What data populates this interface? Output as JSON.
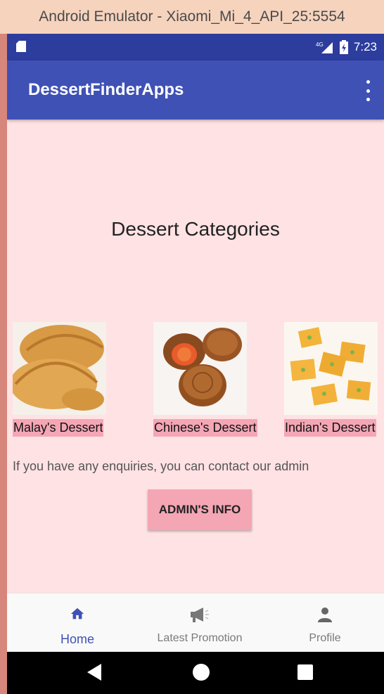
{
  "window": {
    "title": "Android Emulator - Xiaomi_Mi_4_API_25:5554"
  },
  "status_bar": {
    "network": "4G",
    "time": "7:23"
  },
  "app_bar": {
    "title": "DessertFinderApps",
    "overflow_icon": "more-vert-icon"
  },
  "main": {
    "heading": "Dessert Categories",
    "categories": [
      {
        "label": "Malay's Dessert",
        "image": "curry-puff-image"
      },
      {
        "label": "Chinese's Dessert",
        "image": "mooncake-image"
      },
      {
        "label": "Indian's Dessert",
        "image": "barfi-image"
      }
    ],
    "enquiry_text": "If you have any enquiries, you can contact our admin",
    "admin_button_label": "ADMIN'S INFO"
  },
  "bottom_nav": {
    "items": [
      {
        "label": "Home",
        "icon": "home-icon",
        "active": true
      },
      {
        "label": "Latest Promotion",
        "icon": "megaphone-icon",
        "active": false
      },
      {
        "label": "Profile",
        "icon": "person-icon",
        "active": false
      }
    ]
  },
  "colors": {
    "app_bar": "#3f51b5",
    "status_bar": "#2c3d9e",
    "background": "#ffe2e4",
    "accent_pink": "#f4a6b5"
  }
}
